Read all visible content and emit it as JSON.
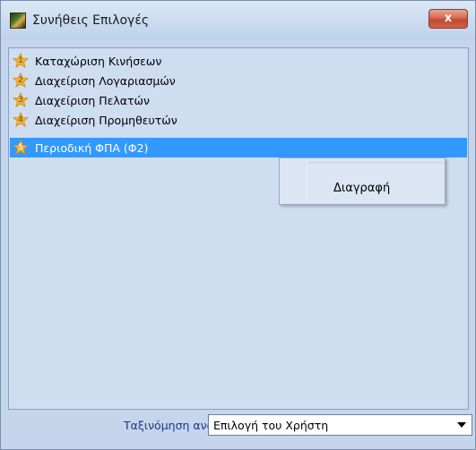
{
  "window": {
    "title": "Συνήθεις Επιλογές",
    "close_glyph": "x",
    "icon": "app-icon"
  },
  "list": {
    "items": [
      {
        "label": "Καταχώριση Κινήσεων",
        "badge": "1",
        "icon": "star-icon",
        "selected": false
      },
      {
        "label": "Διαχείριση Λογαριασμών",
        "badge": "2",
        "icon": "star-icon",
        "selected": false
      },
      {
        "label": "Διαχείριση Πελατών",
        "badge": "3",
        "icon": "star-icon",
        "selected": false
      },
      {
        "label": "Διαχείριση Προμηθευτών",
        "badge": "4",
        "icon": "star-icon",
        "selected": false
      },
      {
        "label": "Περιοδική ΦΠΑ (Φ2)",
        "badge": "5",
        "icon": "star-icon",
        "selected": true
      }
    ],
    "selection_color": "#3399ff"
  },
  "context_menu": {
    "items": [
      {
        "label": "Διαγραφή"
      }
    ]
  },
  "footer": {
    "sort_label": "Ταξινόμηση ανά",
    "sort_value": "Επιλογή του Χρήστη"
  },
  "colors": {
    "window_bg": "#c4d5ec",
    "list_bg": "#cfddf1",
    "close_button": "#c84a32",
    "star": "#f4b233"
  }
}
